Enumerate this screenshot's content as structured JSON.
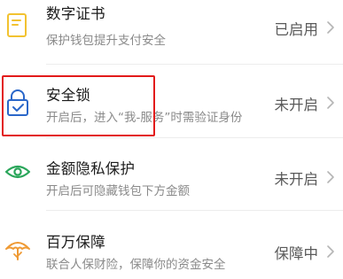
{
  "colors": {
    "cert_icon": "#f2c230",
    "lock_icon": "#2a67c9",
    "privacy_icon": "#2aa65a",
    "insurance_icon": "#ef9a34",
    "annotation_box": "#e21b1b",
    "title_text": "#1b1b1b",
    "subtitle_text": "#8a8a8a",
    "status_text": "#5a5a5a"
  },
  "settings": [
    {
      "icon": "certificate-icon",
      "title": "数字证书",
      "subtitle": "保护钱包提升支付安全",
      "status": "已启用"
    },
    {
      "icon": "lock-icon",
      "title": "安全锁",
      "subtitle": "开启后，进入“我-服务”时需验证身份",
      "status": "未开启"
    },
    {
      "icon": "eye-icon",
      "title": "金额隐私保护",
      "subtitle": "开启后可隐藏钱包下方金额",
      "status": "未开启"
    },
    {
      "icon": "umbrella-icon",
      "title": "百万保障",
      "subtitle": "联合人保财险，保障你的资金安全",
      "status": "保障中"
    }
  ]
}
